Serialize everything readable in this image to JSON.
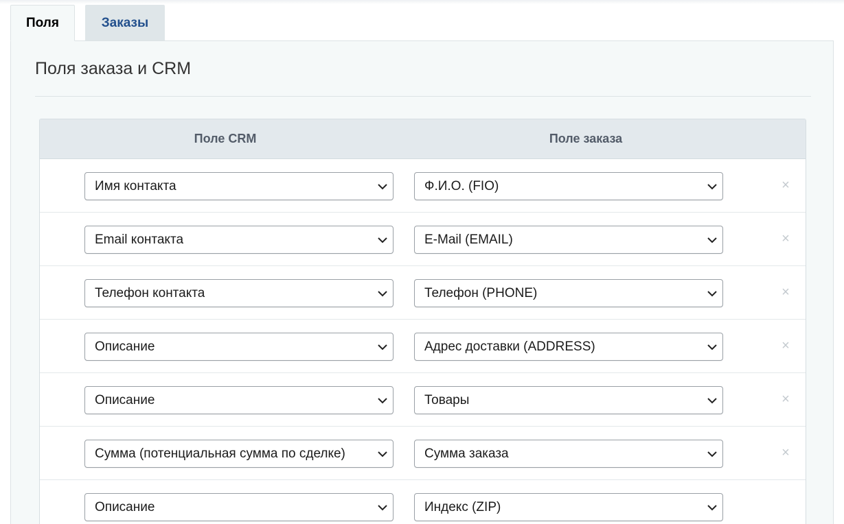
{
  "tabs": [
    {
      "label": "Поля",
      "active": true
    },
    {
      "label": "Заказы",
      "active": false
    }
  ],
  "section": {
    "title": "Поля заказа и CRM"
  },
  "table": {
    "headers": {
      "crm": "Поле CRM",
      "order": "Поле заказа"
    },
    "rows": [
      {
        "crm": "Имя контакта",
        "order": "Ф.И.О. (FIO)",
        "removable": true
      },
      {
        "crm": "Email контакта",
        "order": "E-Mail (EMAIL)",
        "removable": true
      },
      {
        "crm": "Телефон контакта",
        "order": "Телефон (PHONE)",
        "removable": true
      },
      {
        "crm": "Описание",
        "order": "Адрес доставки (ADDRESS)",
        "removable": true
      },
      {
        "crm": "Описание",
        "order": "Товары",
        "removable": true
      },
      {
        "crm": "Сумма (потенциальная сумма по сделке)",
        "order": "Сумма заказа",
        "removable": true
      },
      {
        "crm": "Описание",
        "order": "Индекс (ZIP)",
        "removable": false
      }
    ]
  },
  "icons": {
    "dropdown": "chevron-down-icon",
    "remove": "close-icon"
  },
  "colors": {
    "tab_inactive_text": "#23508d",
    "panel_bg": "#f5f9f9",
    "header_bg": "#e3e9ed",
    "remove_icon": "#c4cacf"
  },
  "glyphs": {
    "remove": "×"
  }
}
